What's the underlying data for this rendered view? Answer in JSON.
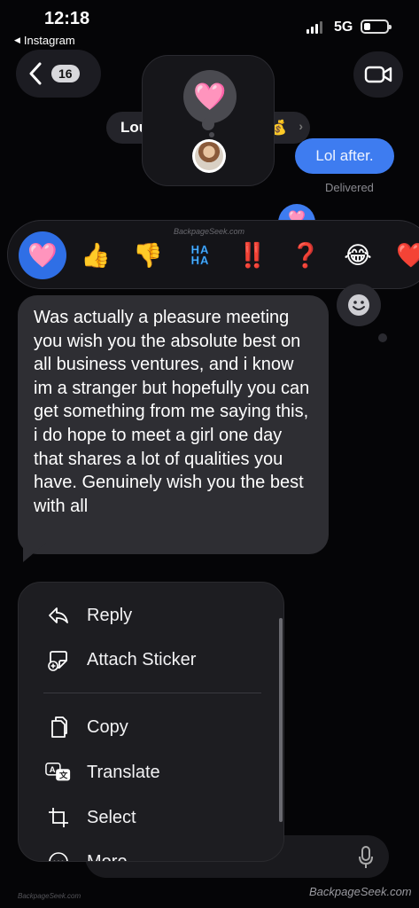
{
  "status": {
    "time": "12:18",
    "back_app": "Instagram",
    "network": "5G"
  },
  "header": {
    "unread_count": "16",
    "contact_name_visible": "Lou",
    "name_emoji": "💰"
  },
  "conversation": {
    "sent_message": "Lol after.",
    "sent_status": "Delivered",
    "received_message": "Was actually a pleasure meeting you wish you the absolute best on all business ventures, and i know im a stranger but hopefully you can get something from me saying this, i do hope to meet a girl one day that shares a lot of qualities you have. Genuinely wish you the best with all"
  },
  "reaction_preview": {
    "emoji": "🩷"
  },
  "reactions": [
    {
      "emoji": "🩷",
      "selected": true
    },
    {
      "emoji": "👍"
    },
    {
      "emoji": "👎"
    },
    {
      "emoji": "HA HA"
    },
    {
      "emoji": "‼️"
    },
    {
      "emoji": "❓"
    },
    {
      "emoji": "😂"
    },
    {
      "emoji": "❤️"
    }
  ],
  "menu": {
    "items": [
      {
        "label": "Reply",
        "icon": "reply-icon"
      },
      {
        "label": "Attach Sticker",
        "icon": "sticker-icon"
      },
      {
        "label": "Copy",
        "icon": "copy-icon"
      },
      {
        "label": "Translate",
        "icon": "translate-icon"
      },
      {
        "label": "Select",
        "icon": "crop-icon"
      },
      {
        "label": "More...",
        "icon": "more-icon"
      }
    ]
  },
  "watermarks": {
    "top": "BackpageSeek.com",
    "bottom_left": "BackpageSeek.com",
    "bottom_right": "BackpageSeek.com"
  },
  "colors": {
    "sent_bubble": "#3e7cf0",
    "received_bubble": "#2e2e33",
    "selected_reaction": "#2f6fe6",
    "background": "#050507"
  }
}
